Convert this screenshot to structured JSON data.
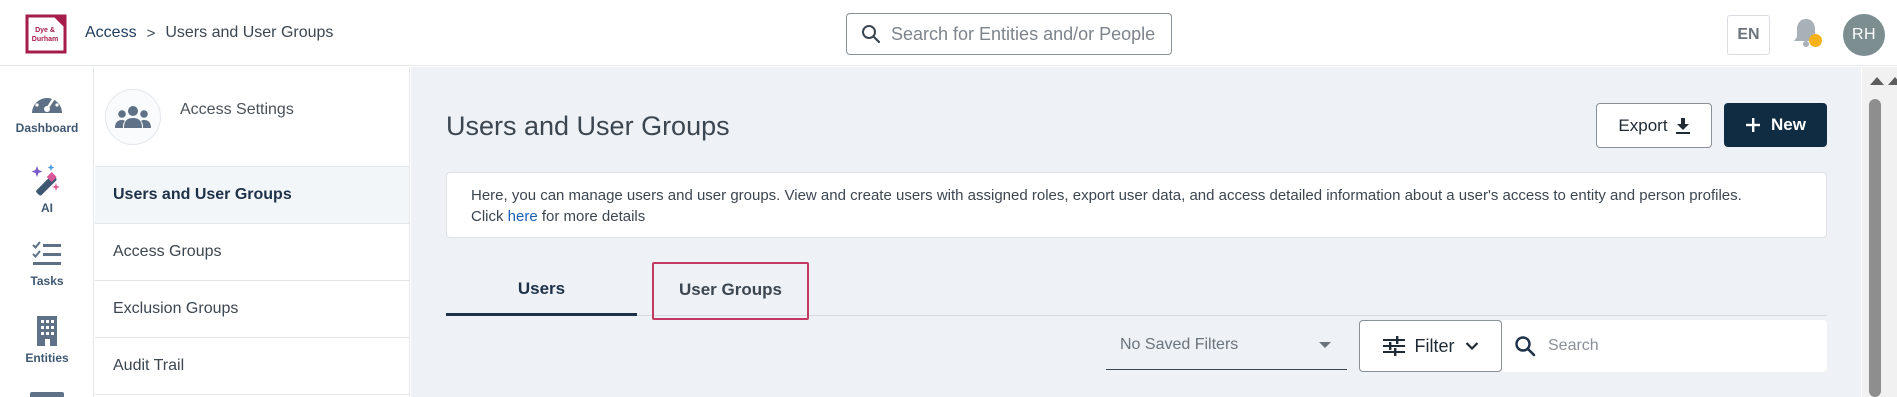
{
  "header": {
    "logo_text": [
      "Dye &",
      "Durham"
    ],
    "breadcrumb": {
      "parent": "Access",
      "separator": ">",
      "current": "Users and User Groups"
    },
    "search_placeholder": "Search for Entities and/or People",
    "language": "EN",
    "avatar_initials": "RH",
    "colors": {
      "brand": "#a51c4b",
      "notification_dot": "#f6b21a",
      "avatar_bg": "#7d8e91"
    }
  },
  "rail": {
    "items": [
      {
        "label": "Dashboard",
        "icon": "speedometer-icon"
      },
      {
        "label": "AI",
        "icon": "magic-wand-icon"
      },
      {
        "label": "Tasks",
        "icon": "checklist-icon"
      },
      {
        "label": "Entities",
        "icon": "building-icon"
      }
    ]
  },
  "panel": {
    "title": "Access Settings",
    "icon": "people-group-icon",
    "items": [
      {
        "label": "Users and User Groups",
        "active": true
      },
      {
        "label": "Access Groups"
      },
      {
        "label": "Exclusion Groups"
      },
      {
        "label": "Audit Trail"
      }
    ]
  },
  "main": {
    "title": "Users and User Groups",
    "export_label": "Export",
    "new_label": "New",
    "info_text": "Here, you can manage users and user groups. View and create users with assigned roles, export user data, and access detailed information about a user's access to entity and person profiles.",
    "info_click": "Click",
    "info_link": "here",
    "info_suffix": "for more details",
    "tabs": [
      {
        "label": "Users",
        "active": true
      },
      {
        "label": "User Groups"
      }
    ],
    "saved_filters_value": "No Saved Filters",
    "filter_label": "Filter",
    "search_placeholder": "Search",
    "colors": {
      "primary_button": "#102c42",
      "highlight_border": "#c23a63",
      "link": "#1a5fb4"
    }
  }
}
